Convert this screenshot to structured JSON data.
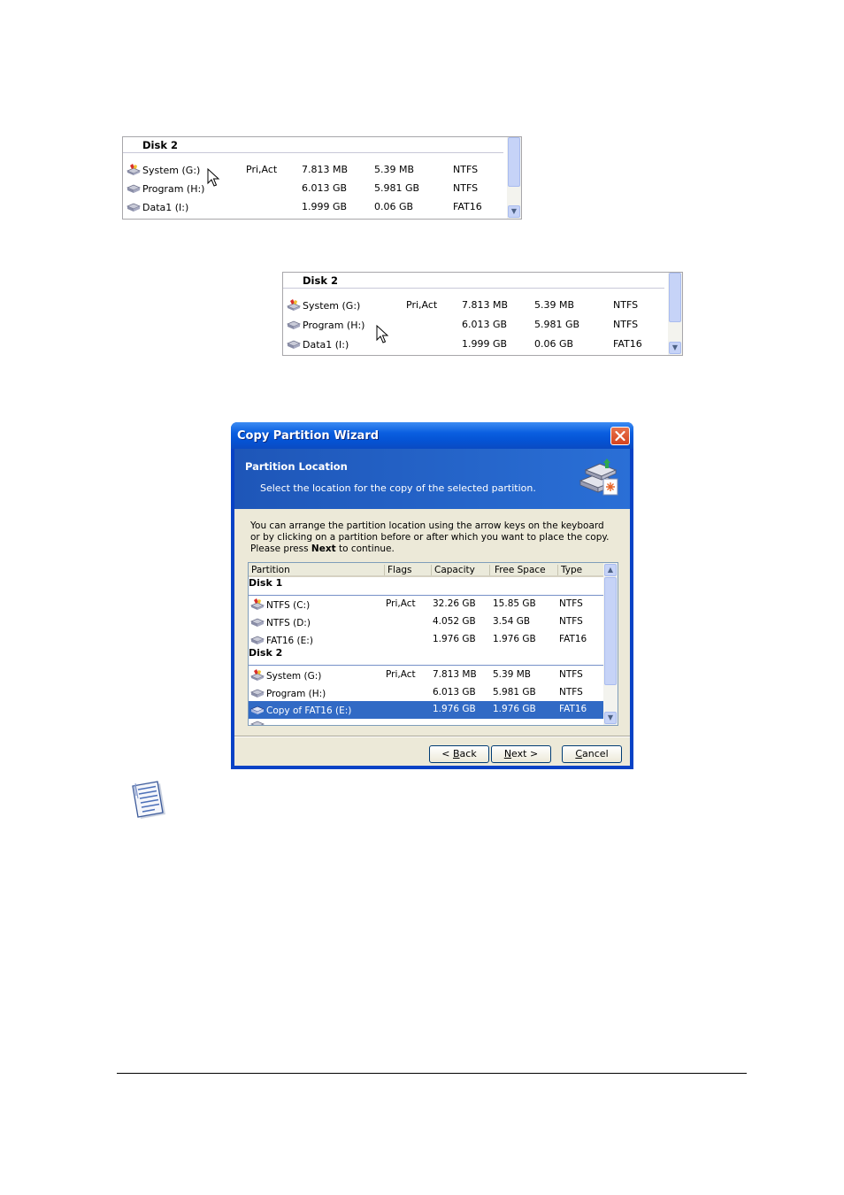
{
  "snippet_top": {
    "disk_label": "Disk 2",
    "rows": [
      {
        "name": "System (G:)",
        "flags": "Pri,Act",
        "capacity": "7.813 MB",
        "free": "5.39 MB",
        "type": "NTFS",
        "icon": "system-partition-icon"
      },
      {
        "name": "Program (H:)",
        "flags": "",
        "capacity": "6.013 GB",
        "free": "5.981 GB",
        "type": "NTFS",
        "icon": "partition-icon"
      },
      {
        "name": "Data1 (I:)",
        "flags": "",
        "capacity": "1.999 GB",
        "free": "0.06 GB",
        "type": "FAT16",
        "icon": "partition-icon"
      }
    ]
  },
  "snippet_bottom": {
    "disk_label": "Disk 2",
    "rows": [
      {
        "name": "System (G:)",
        "flags": "Pri,Act",
        "capacity": "7.813 MB",
        "free": "5.39 MB",
        "type": "NTFS",
        "icon": "system-partition-icon"
      },
      {
        "name": "Program (H:)",
        "flags": "",
        "capacity": "6.013 GB",
        "free": "5.981 GB",
        "type": "NTFS",
        "icon": "partition-icon"
      },
      {
        "name": "Data1 (I:)",
        "flags": "",
        "capacity": "1.999 GB",
        "free": "0.06 GB",
        "type": "FAT16",
        "icon": "partition-icon"
      }
    ]
  },
  "wizard": {
    "title": "Copy Partition Wizard",
    "banner_title": "Partition Location",
    "banner_subtitle": "Select the location for the copy of the selected partition.",
    "desc_part1": "You can arrange the partition location using the arrow keys on the keyboard or by clicking on a partition before or after which you want to place the copy. Please press ",
    "desc_bold": "Next",
    "desc_part2": " to continue.",
    "columns": [
      "Partition",
      "Flags",
      "Capacity",
      "Free Space",
      "Type"
    ],
    "disk1_label": "Disk 1",
    "disk1_rows": [
      {
        "name": "NTFS (C:)",
        "flags": "Pri,Act",
        "capacity": "32.26 GB",
        "free": "15.85 GB",
        "type": "NTFS"
      },
      {
        "name": "NTFS (D:)",
        "flags": "",
        "capacity": "4.052 GB",
        "free": "3.54 GB",
        "type": "NTFS"
      },
      {
        "name": "FAT16 (E:)",
        "flags": "",
        "capacity": "1.976 GB",
        "free": "1.976 GB",
        "type": "FAT16"
      }
    ],
    "disk2_label": "Disk 2",
    "disk2_rows": [
      {
        "name": "System (G:)",
        "flags": "Pri,Act",
        "capacity": "7.813 MB",
        "free": "5.39 MB",
        "type": "NTFS"
      },
      {
        "name": "Program (H:)",
        "flags": "",
        "capacity": "6.013 GB",
        "free": "5.981 GB",
        "type": "NTFS"
      },
      {
        "name": "Copy of FAT16 (E:)",
        "flags": "",
        "capacity": "1.976 GB",
        "free": "1.976 GB",
        "type": "FAT16",
        "selected": true
      }
    ],
    "back_label_prefix": "< ",
    "back_label_u": "B",
    "back_label_rest": "ack",
    "next_label_u": "N",
    "next_label_rest": "ext >",
    "cancel_label_u": "C",
    "cancel_label_rest": "ancel"
  },
  "colors": {
    "selection": "#316ac5",
    "title_bar": "#0553d4",
    "dialog_face": "#ece9d8"
  }
}
